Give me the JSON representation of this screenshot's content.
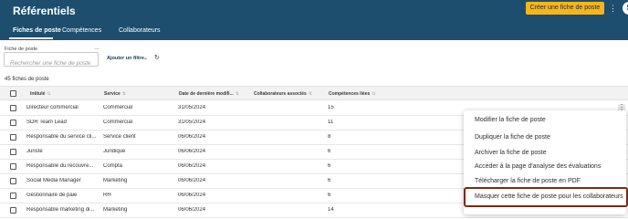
{
  "header": {
    "title": "Référentiels",
    "create_button": "Créer une fiche de poste",
    "avatar_initial": "S",
    "tabs": [
      {
        "label": "Fiches de poste",
        "active": true
      },
      {
        "label": "Compétences",
        "active": false
      },
      {
        "label": "Collaborateurs",
        "active": false
      }
    ]
  },
  "filters": {
    "label": "Fiche de poste",
    "search_placeholder": "Rechercher une fiche de poste",
    "add_filter": "Ajouter un filtre",
    "more": "...",
    "refresh": "↻"
  },
  "result_count": "45 fiches de poste",
  "table": {
    "columns": [
      "Intitulé",
      "Service",
      "Date de dernière modifi...",
      "Collaborateurs associés",
      "Compétences liées"
    ],
    "rows": [
      {
        "title": "Directeur commercial",
        "service": "Commercial",
        "date": "31/05/2024",
        "collaborators": "",
        "skills": "15"
      },
      {
        "title": "SDR Team Lead",
        "service": "Commercial",
        "date": "31/05/2024",
        "collaborators": "",
        "skills": "11"
      },
      {
        "title": "Responsable du service cli...",
        "service": "Service client",
        "date": "06/06/2024",
        "collaborators": "",
        "skills": "8"
      },
      {
        "title": "Juriste",
        "service": "Juridique",
        "date": "06/06/2024",
        "collaborators": "",
        "skills": "6"
      },
      {
        "title": "Responsable du recouvre...",
        "service": "Compta",
        "date": "06/06/2024",
        "collaborators": "",
        "skills": "6"
      },
      {
        "title": "Social Media Manager",
        "service": "Marketing",
        "date": "06/06/2024",
        "collaborators": "",
        "skills": "6"
      },
      {
        "title": "Gestionnaire de paie",
        "service": "RH",
        "date": "06/06/2024",
        "collaborators": "",
        "skills": "6"
      },
      {
        "title": "Responsable marketing di...",
        "service": "Marketing",
        "date": "06/06/2024",
        "collaborators": "",
        "skills": "14"
      }
    ]
  },
  "context_menu": {
    "items": [
      "Modifier la fiche de poste",
      "Dupliquer la fiche de poste",
      "Archiver la fiche de poste",
      "Accéder à la page d'analyse des évaluations",
      "Télécharger la fiche de poste en PDF",
      "Masquer cette fiche de poste pour les collaborateurs"
    ],
    "highlighted_index": 5
  },
  "colors": {
    "header_bg": "#1d4e6e",
    "accent": "#f5b61c",
    "highlight_border": "#7a2a12"
  }
}
